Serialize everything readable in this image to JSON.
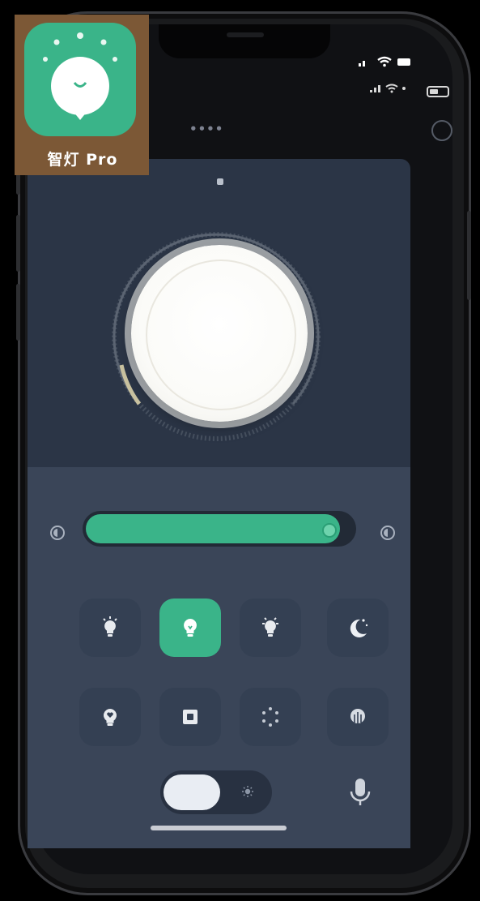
{
  "app": {
    "name": "智灯 Pro",
    "accent_color": "#3ab489",
    "panel_color": "#2b3546"
  },
  "status_bar": {
    "signal_icon": "signal-icon",
    "wifi_icon": "wifi-icon",
    "battery_icon": "battery-icon"
  },
  "nav": {
    "title": "••••",
    "more_icon": "more-circle-icon"
  },
  "light": {
    "power_knob_icon": "power-knob",
    "page_indicator_icon": "page-dot"
  },
  "brightness": {
    "level_percent": 95,
    "low_icon": "brightness-low-icon",
    "high_icon": "brightness-high-icon"
  },
  "modes": [
    {
      "name": "reading",
      "icon": "bulb-rays-icon",
      "active": false
    },
    {
      "name": "bulb",
      "icon": "bulb-icon",
      "active": true
    },
    {
      "name": "bright",
      "icon": "bulb-spark-icon",
      "active": false
    },
    {
      "name": "night",
      "icon": "moon-stars-icon",
      "active": false
    },
    {
      "name": "heart",
      "icon": "bulb-heart-icon",
      "active": false
    },
    {
      "name": "scene",
      "icon": "square-frame-icon",
      "active": false
    },
    {
      "name": "dots",
      "icon": "dots-ring-icon",
      "active": false
    },
    {
      "name": "fingerprint",
      "icon": "fingerprint-icon",
      "active": false
    }
  ],
  "bottom_bar": {
    "toggle_on": true,
    "toggle_icon": "sun-icon",
    "mic_icon": "mic-icon"
  }
}
